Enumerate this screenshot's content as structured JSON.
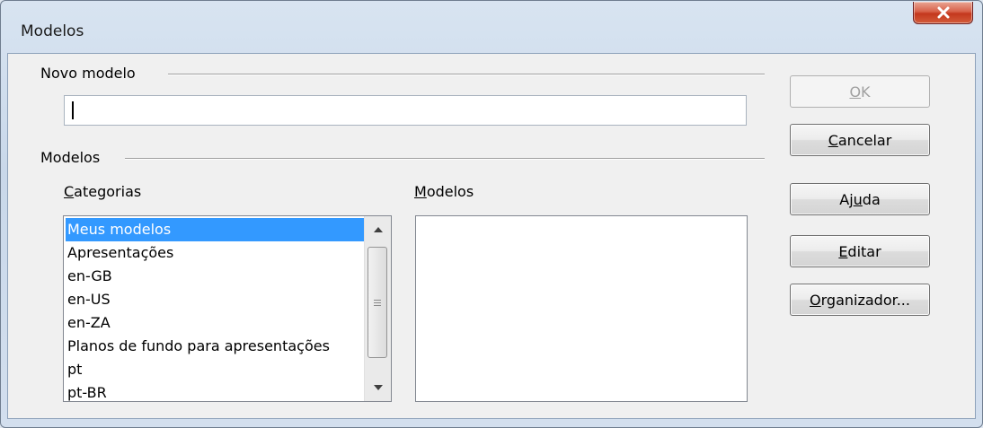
{
  "window": {
    "title": "Modelos"
  },
  "new_template": {
    "group_label": "Novo modelo",
    "input_value": ""
  },
  "templates": {
    "group_label": "Modelos",
    "categories_label": "Categorias",
    "categories_mnemonic": "C",
    "categories_rest": "ategorias",
    "models_label": "Modelos",
    "models_mnemonic": "M",
    "models_rest": "odelos",
    "categories": [
      "Meus modelos",
      "Apresentações",
      "en-GB",
      "en-US",
      "en-ZA",
      "Planos de fundo para apresentações",
      "pt",
      "pt-BR"
    ],
    "selected_category": "Meus modelos",
    "models": []
  },
  "buttons": {
    "ok": {
      "mnemonic": "O",
      "rest": "K"
    },
    "cancel": {
      "mnemonic": "C",
      "rest": "ancelar"
    },
    "help": {
      "pre": "Aj",
      "mnemonic": "u",
      "rest": "da"
    },
    "edit": {
      "mnemonic": "E",
      "rest": "ditar"
    },
    "organizer": {
      "mnemonic": "O",
      "rest": "rganizador..."
    }
  },
  "colors": {
    "selection": "#3399ff",
    "close_button": "#c4381e"
  },
  "icons": {
    "close": "close-x-icon",
    "scroll_up": "chevron-up-icon",
    "scroll_down": "chevron-down-icon",
    "scroll_grip": "grip-lines-icon"
  }
}
